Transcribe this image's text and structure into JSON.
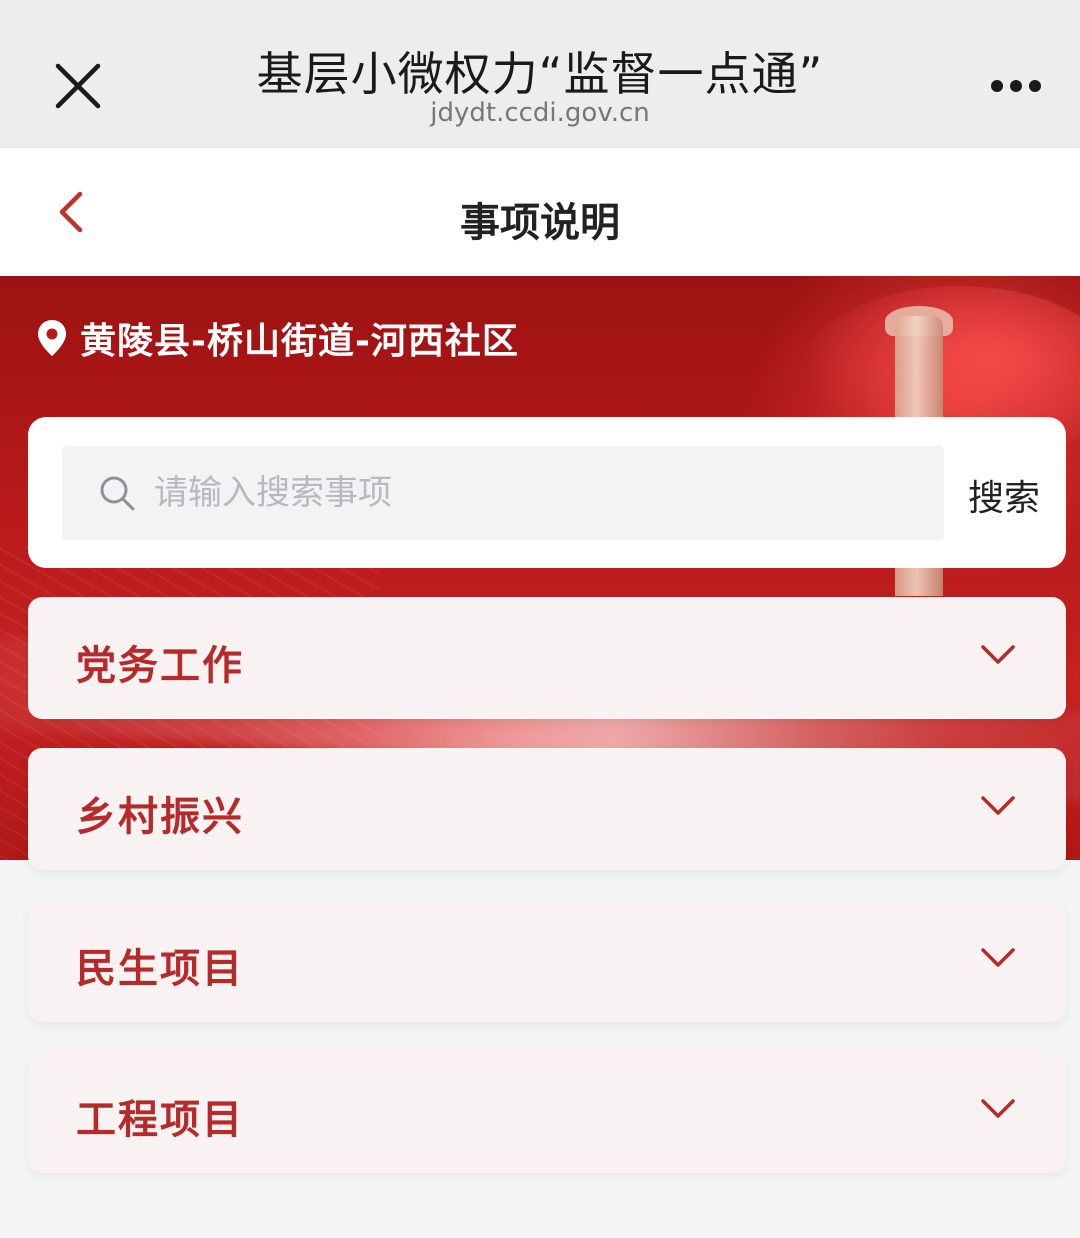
{
  "browser": {
    "title": "基层小微权力“监督一点通”",
    "url": "jdydt.ccdi.gov.cn"
  },
  "header": {
    "title": "事项说明"
  },
  "location": {
    "text": "黄陵县-桥山街道-河西社区"
  },
  "search": {
    "placeholder": "请输入搜索事项",
    "button_label": "搜索"
  },
  "categories": [
    {
      "label": "党务工作"
    },
    {
      "label": "乡村振兴"
    },
    {
      "label": "民生项目"
    },
    {
      "label": "工程项目"
    }
  ],
  "colors": {
    "accent": "#b52a2a",
    "banner": "#b81a1a"
  },
  "icons": [
    "close-icon",
    "more-icon",
    "back-icon",
    "location-pin-icon",
    "search-icon",
    "chevron-down-icon"
  ]
}
